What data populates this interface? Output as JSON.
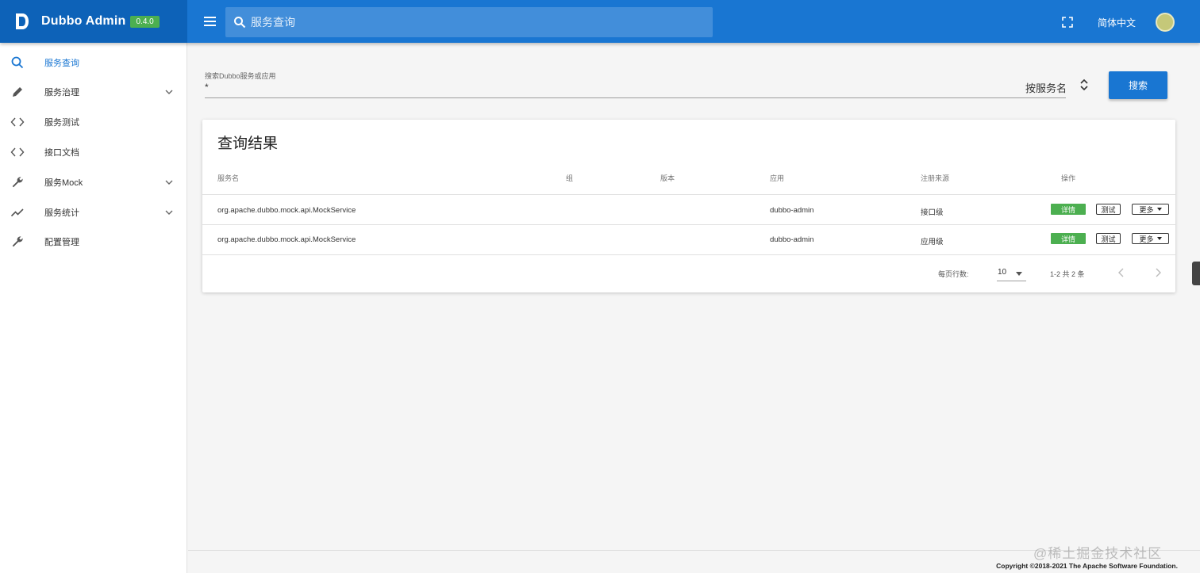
{
  "header": {
    "app_name": "Dubbo Admin",
    "version": "0.4.0",
    "search_placeholder": "服务查询",
    "language": "简体中文"
  },
  "sidebar": {
    "items": [
      {
        "label": "服务查询",
        "icon": "search-icon",
        "active": true,
        "has_children": false
      },
      {
        "label": "服务治理",
        "icon": "pencil-icon",
        "active": false,
        "has_children": true
      },
      {
        "label": "服务测试",
        "icon": "code-icon",
        "active": false,
        "has_children": false
      },
      {
        "label": "接口文档",
        "icon": "code-icon",
        "active": false,
        "has_children": false
      },
      {
        "label": "服务Mock",
        "icon": "wrench-icon",
        "active": false,
        "has_children": true
      },
      {
        "label": "服务统计",
        "icon": "trending-icon",
        "active": false,
        "has_children": true
      },
      {
        "label": "配置管理",
        "icon": "wrench-icon",
        "active": false,
        "has_children": false
      }
    ]
  },
  "search_form": {
    "label": "搜索Dubbo服务或应用",
    "value": "*",
    "sort_by": "按服务名",
    "button": "搜索"
  },
  "results": {
    "title": "查询结果",
    "columns": [
      "服务名",
      "组",
      "版本",
      "应用",
      "注册来源",
      "操作"
    ],
    "rows": [
      {
        "service": "org.apache.dubbo.mock.api.MockService",
        "group": "",
        "version": "",
        "app": "dubbo-admin",
        "source": "接口级"
      },
      {
        "service": "org.apache.dubbo.mock.api.MockService",
        "group": "",
        "version": "",
        "app": "dubbo-admin",
        "source": "应用级"
      }
    ],
    "actions": {
      "detail": "详情",
      "test": "测试",
      "more": "更多"
    },
    "pagination": {
      "rows_per_page_label": "每页行数:",
      "rows_per_page": "10",
      "range": "1-2 共 2 条"
    }
  },
  "footer": {
    "copyright": "Copyright ©2018-2021 The Apache Software Foundation.",
    "watermark": "@稀土掘金技术社区"
  },
  "colors": {
    "primary": "#1976d2",
    "brand_bg": "#0d62b8",
    "success": "#4caf50"
  }
}
